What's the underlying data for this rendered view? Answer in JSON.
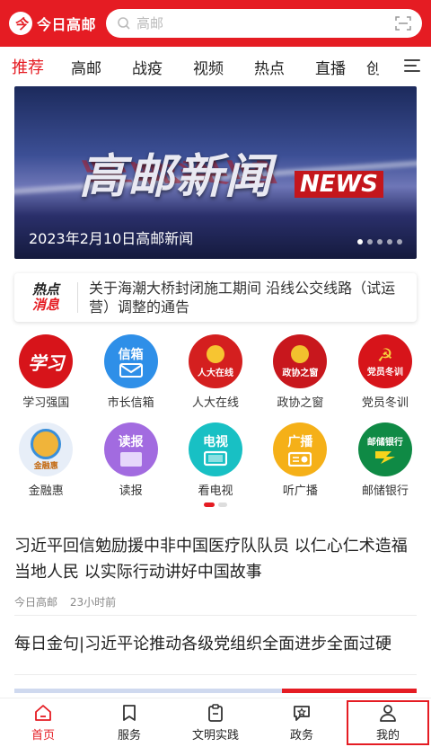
{
  "header": {
    "logo_mark": "今",
    "logo_text": "今日高邮",
    "search_placeholder": "高邮"
  },
  "tabs": [
    {
      "label": "推荐",
      "active": true
    },
    {
      "label": "高邮"
    },
    {
      "label": "战疫"
    },
    {
      "label": "视频"
    },
    {
      "label": "热点"
    },
    {
      "label": "直播"
    },
    {
      "label": "创"
    }
  ],
  "banner": {
    "title": "高邮新闻",
    "tag": "NEWS",
    "caption": "2023年2月10日高邮新闻",
    "slides": 5,
    "current": 1
  },
  "hot": {
    "tag_line1": "热点",
    "tag_line2": "消息",
    "text": "关于海潮大桥封闭施工期间 沿线公交线路（试运营）调整的通告"
  },
  "services": [
    {
      "label": "学习强国",
      "icon": "xuexi-icon",
      "text": "学习",
      "color": "#d7141a"
    },
    {
      "label": "市长信箱",
      "icon": "mailbox-icon",
      "text": "信箱",
      "color": "#2e8fe8"
    },
    {
      "label": "人大在线",
      "icon": "npc-emblem-icon",
      "text": "人大在线",
      "color": "#d41f1f"
    },
    {
      "label": "政协之窗",
      "icon": "cppcc-emblem-icon",
      "text": "政协之窗",
      "color": "#c8171d"
    },
    {
      "label": "党员冬训",
      "icon": "party-icon",
      "text": "党员冬训",
      "color": "#d7141a"
    },
    {
      "label": "金融惠",
      "icon": "finance-icon",
      "text": "金融惠",
      "color": "#3a8fd9"
    },
    {
      "label": "读报",
      "icon": "newspaper-icon",
      "text": "读报",
      "color": "#a26be0"
    },
    {
      "label": "看电视",
      "icon": "tv-icon",
      "text": "电视",
      "color": "#18c0c4"
    },
    {
      "label": "听广播",
      "icon": "radio-icon",
      "text": "广播",
      "color": "#f5b018"
    },
    {
      "label": "邮储银行",
      "icon": "psbc-icon",
      "text": "邮储银行",
      "color": "#0f8a45"
    }
  ],
  "articles": [
    {
      "title": "习近平回信勉励援中非中国医疗队队员 以仁心仁术造福当地人民 以实际行动讲好中国故事",
      "source": "今日高邮",
      "time": "23小时前"
    },
    {
      "title": "每日金句|习近平论推动各级党组织全面进步全面过硬"
    }
  ],
  "bottom_nav": [
    {
      "label": "首页",
      "icon": "home-icon",
      "active": true
    },
    {
      "label": "服务",
      "icon": "bookmark-icon"
    },
    {
      "label": "文明实践",
      "icon": "clipboard-icon"
    },
    {
      "label": "政务",
      "icon": "star-chat-icon"
    },
    {
      "label": "我的",
      "icon": "user-icon",
      "highlighted": true
    }
  ],
  "colors": {
    "accent": "#e51c23"
  }
}
